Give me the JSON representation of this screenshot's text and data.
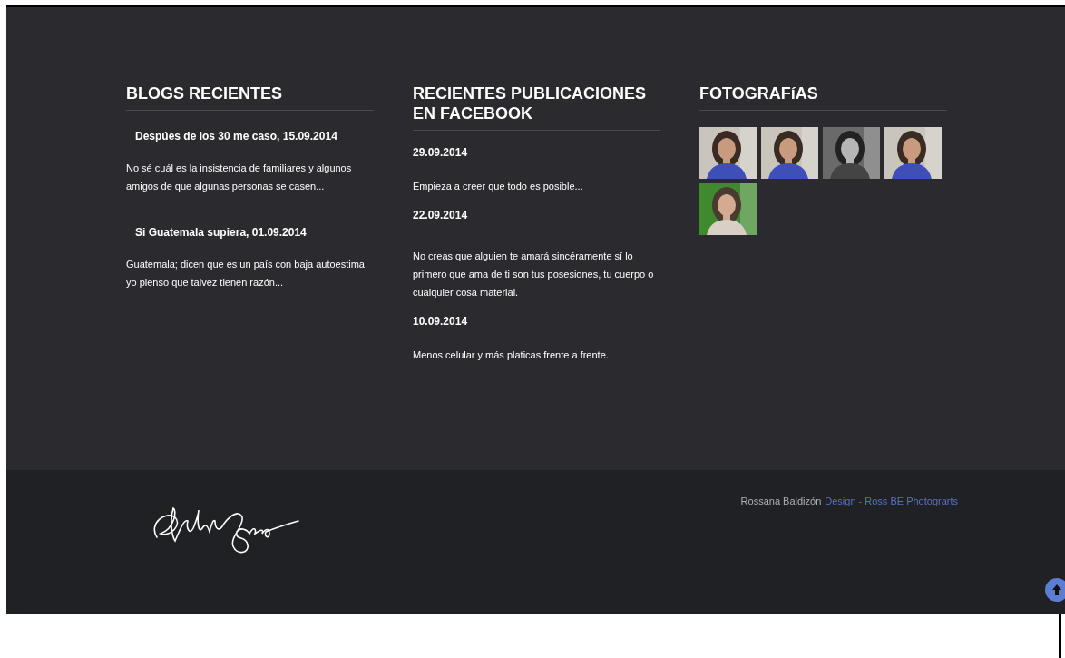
{
  "blogs": {
    "title": "BLOGS RECIENTES",
    "posts": [
      {
        "title": "Despúes de los 30 me caso, 15.09.2014",
        "excerpt": "No sé cuál es la insistencia de familiares y algunos amigos de que algunas personas se casen..."
      },
      {
        "title": "Si Guatemala supiera, 01.09.2014",
        "excerpt": "Guatemala; dicen que es un país con baja autoestima, yo pienso que talvez tienen razón..."
      }
    ]
  },
  "facebook": {
    "title": "RECIENTES PUBLICACIONES EN FACEBOOK",
    "posts": [
      {
        "date": "29.09.2014",
        "text": "Empieza a creer que todo es posible..."
      },
      {
        "date": "22.09.2014",
        "text": "No creas que alguien te amará sincéramente sí lo primero que ama de ti son tus posesiones, tu cuerpo o cualquier cosa material."
      },
      {
        "date": "10.09.2014",
        "text": "Menos celular y más platicas frente a frente."
      }
    ]
  },
  "photos": {
    "title": "FOTOGRAFíAS"
  },
  "footer": {
    "author": "Rossana Baldizón",
    "link": "Design - Ross BE Photograrts"
  }
}
